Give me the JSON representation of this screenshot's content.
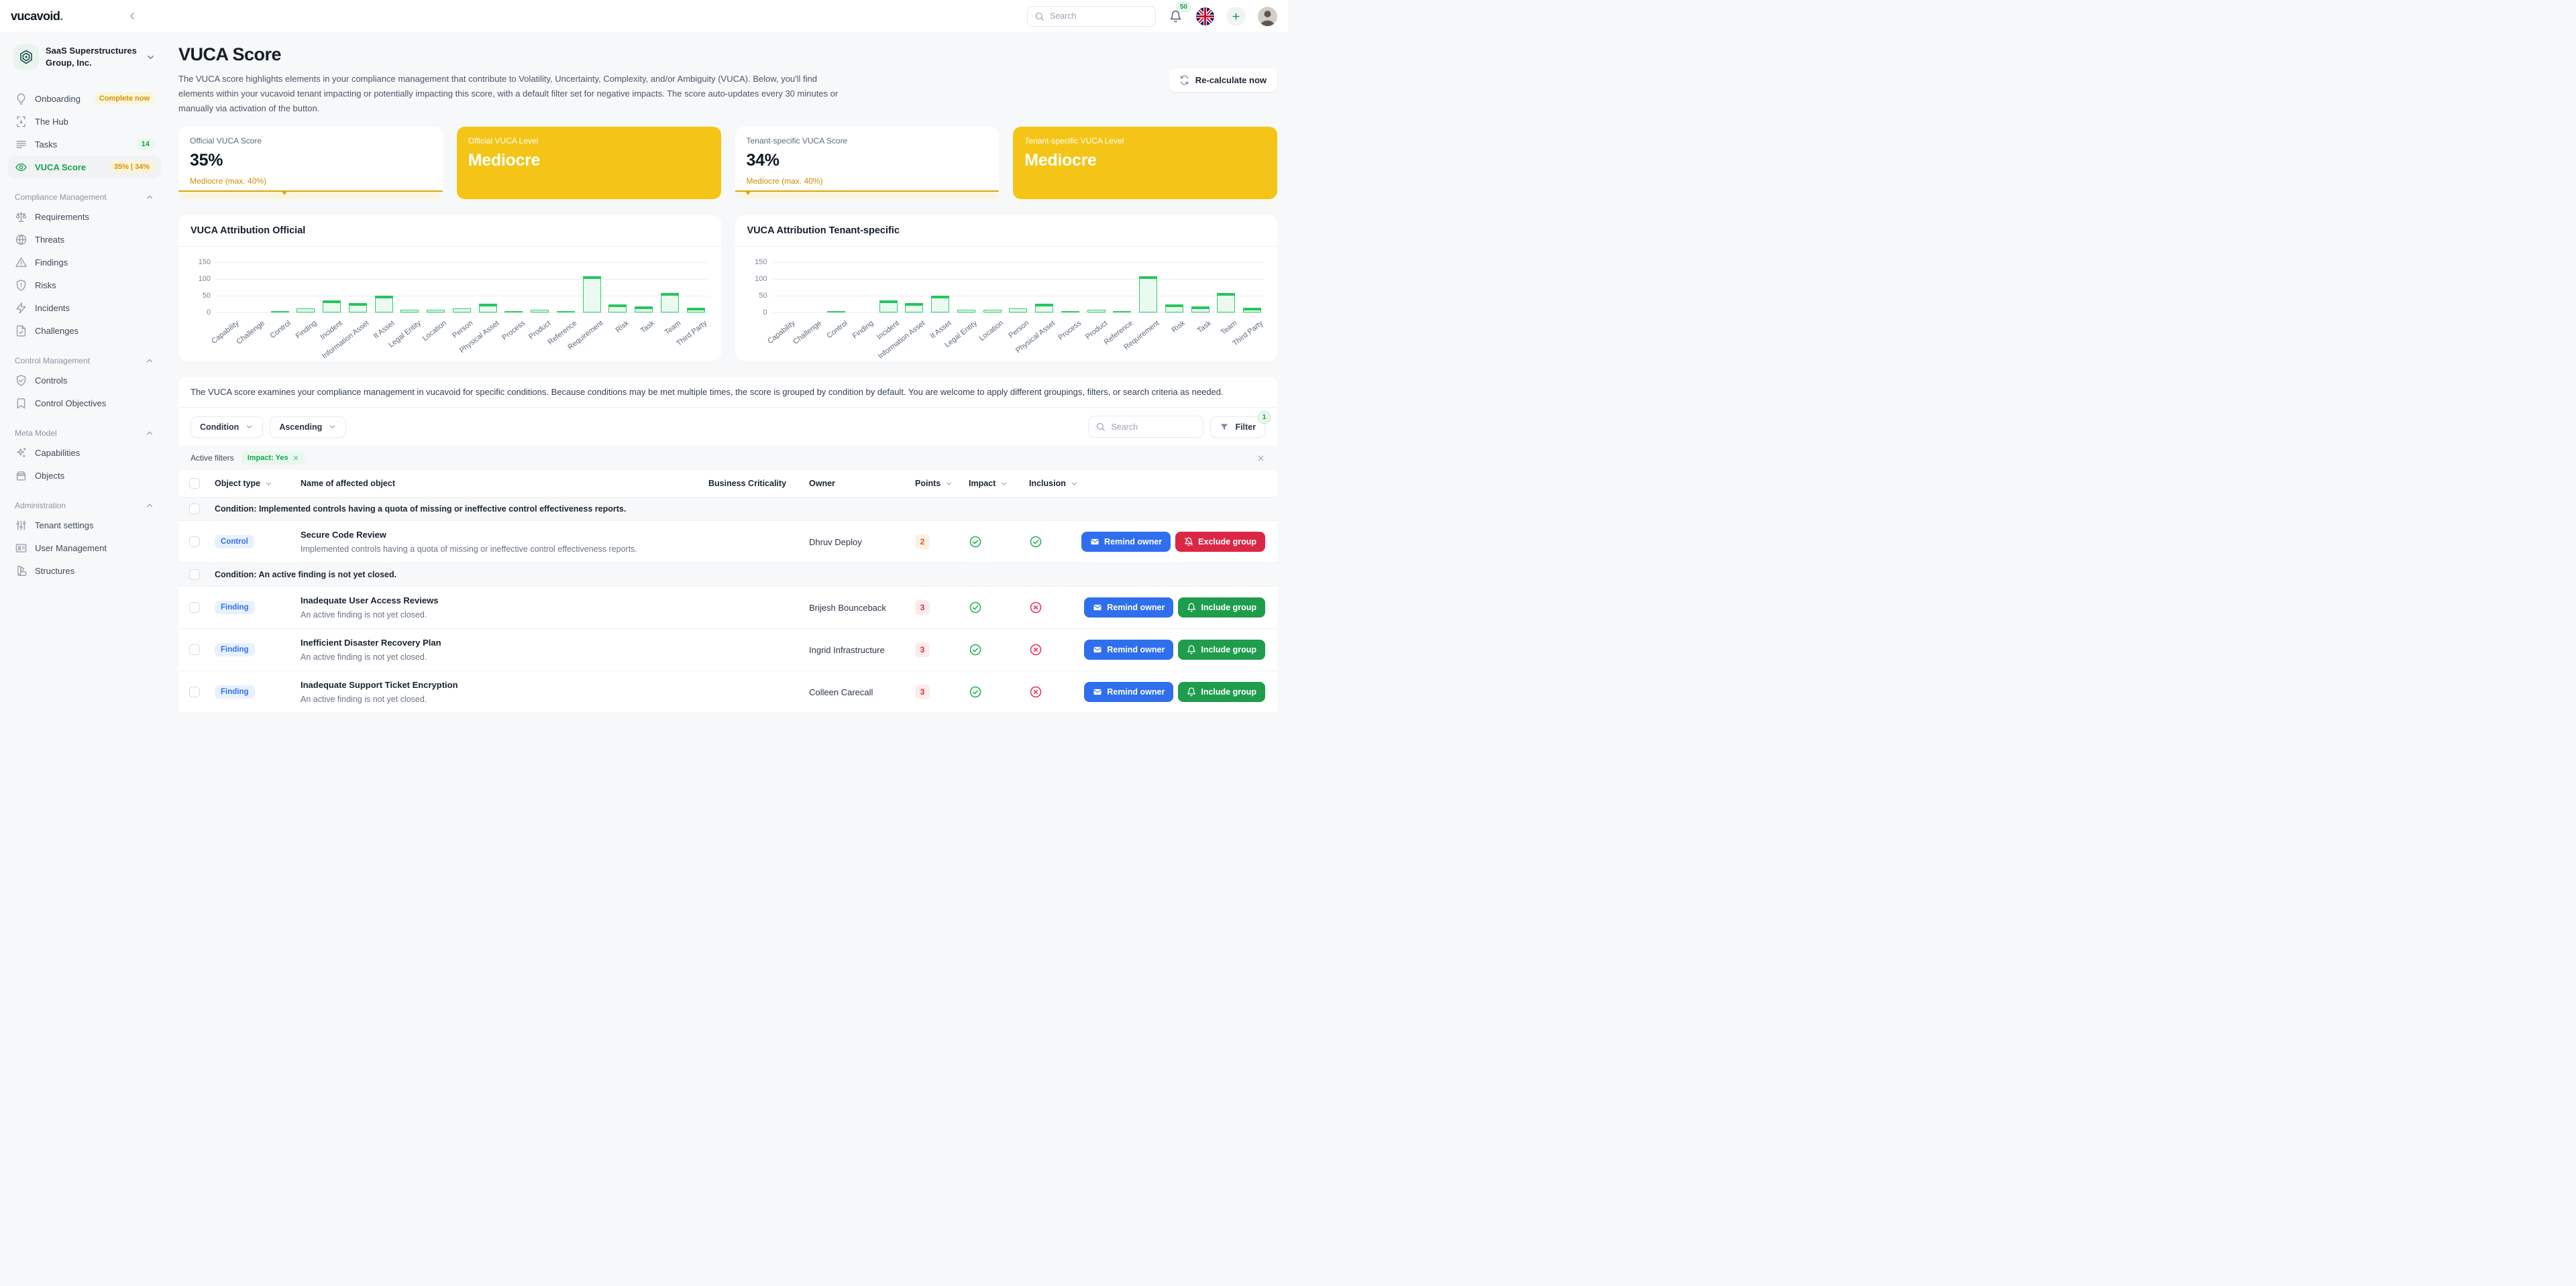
{
  "colors": {
    "accent_green": "#18a24b",
    "yellow": "#f4c516",
    "amber_text": "#c79104",
    "blue": "#2f6fed",
    "red": "#dc2645",
    "green_button": "#1f9d4d"
  },
  "topbar": {
    "logo": "vucavoid",
    "logo_dot": ".",
    "search_placeholder": "Search",
    "notification_count": "50"
  },
  "sidebar": {
    "org_name": "SaaS Superstructures Group, Inc.",
    "items_top": [
      {
        "label": "Onboarding",
        "icon": "lightbulb",
        "badge": "Complete now",
        "badge_style": "yellow"
      },
      {
        "label": "The Hub",
        "icon": "move"
      },
      {
        "label": "Tasks",
        "icon": "list",
        "badge": "14",
        "badge_style": "green"
      },
      {
        "label": "VUCA Score",
        "icon": "eye",
        "badge": "35% | 34%",
        "badge_style": "yellow",
        "active": true
      }
    ],
    "sections": [
      {
        "title": "Compliance Management",
        "items": [
          {
            "label": "Requirements",
            "icon": "scale"
          },
          {
            "label": "Threats",
            "icon": "globe"
          },
          {
            "label": "Findings",
            "icon": "alert-triangle"
          },
          {
            "label": "Risks",
            "icon": "shield-alert"
          },
          {
            "label": "Incidents",
            "icon": "zap"
          },
          {
            "label": "Challenges",
            "icon": "file-check"
          }
        ]
      },
      {
        "title": "Control Management",
        "items": [
          {
            "label": "Controls",
            "icon": "shield-check"
          },
          {
            "label": "Control Objectives",
            "icon": "bookmark"
          }
        ]
      },
      {
        "title": "Meta Model",
        "items": [
          {
            "label": "Capabilities",
            "icon": "sparkles"
          },
          {
            "label": "Objects",
            "icon": "box"
          }
        ]
      },
      {
        "title": "Administration",
        "items": [
          {
            "label": "Tenant settings",
            "icon": "sliders"
          },
          {
            "label": "User Management",
            "icon": "id-card"
          },
          {
            "label": "Structures",
            "icon": "swatch"
          }
        ]
      }
    ]
  },
  "header": {
    "title": "VUCA Score",
    "description": "The VUCA score highlights elements in your compliance management that contribute to Volatility, Uncertainty, Complexity, and/or Ambiguity (VUCA). Below, you'll find elements within your vucavoid tenant impacting or potentially impacting this score, with a default filter set for negative impacts. The score auto-updates every 30 minutes or manually via activation of the button.",
    "recalculate_label": "Re-calculate now"
  },
  "score_cards": [
    {
      "label": "Official VUCA Score",
      "value": "35%",
      "sublabel": "Mediocre (max. 40%)",
      "style": "white",
      "marker_pos": 40
    },
    {
      "label": "Official VUCA Level",
      "value": "Mediocre",
      "style": "yellow"
    },
    {
      "label": "Tenant-specific VUCA Score",
      "value": "34%",
      "sublabel": "Mediocre (max. 40%)",
      "style": "white",
      "marker_pos": 5
    },
    {
      "label": "Tenant-specific VUCA Level",
      "value": "Mediocre",
      "style": "yellow"
    }
  ],
  "chart_data": [
    {
      "type": "bar",
      "title": "VUCA Attribution Official",
      "categories": [
        "Capability",
        "Challenge",
        "Control",
        "Finding",
        "Incident",
        "Information Asset",
        "It Asset",
        "Legal Entity",
        "Location",
        "Person",
        "Physical Asset",
        "Process",
        "Product",
        "Reference",
        "Requirement",
        "Risk",
        "Task",
        "Team",
        "Third Party"
      ],
      "values": [
        0,
        0,
        2,
        13,
        36,
        29,
        50,
        8,
        8,
        13,
        26,
        2,
        8,
        3,
        108,
        25,
        19,
        59,
        14
      ],
      "xlabel": "",
      "ylabel": "",
      "ylim": [
        0,
        160
      ],
      "yticks": [
        0,
        50,
        100,
        150
      ],
      "grid": true,
      "legend": false,
      "bar_fill": "#eafaf1",
      "bar_border": "#2fce66"
    },
    {
      "type": "bar",
      "title": "VUCA Attribution Tenant-specific",
      "categories": [
        "Capability",
        "Challenge",
        "Control",
        "Finding",
        "Incident",
        "Information Asset",
        "It Asset",
        "Legal Entity",
        "Location",
        "Person",
        "Physical Asset",
        "Process",
        "Product",
        "Reference",
        "Requirement",
        "Risk",
        "Task",
        "Team",
        "Third Party"
      ],
      "values": [
        0,
        0,
        2,
        0,
        36,
        29,
        50,
        8,
        8,
        13,
        26,
        2,
        8,
        3,
        108,
        25,
        19,
        59,
        14
      ],
      "xlabel": "",
      "ylabel": "",
      "ylim": [
        0,
        160
      ],
      "yticks": [
        0,
        50,
        100,
        150
      ],
      "grid": true,
      "legend": false,
      "bar_fill": "#eafaf1",
      "bar_border": "#2fce66"
    }
  ],
  "table": {
    "intro": "The VUCA score examines your compliance management in vucavoid for specific conditions. Because conditions may be met multiple times, the score is grouped by condition by default. You are welcome to apply different groupings, filters, or search criteria as needed.",
    "sort_field": "Condition",
    "sort_direction": "Ascending",
    "search_placeholder": "Search",
    "filter_label": "Filter",
    "filter_count": "1",
    "active_filters_label": "Active filters",
    "active_filter_pill": "Impact: Yes",
    "columns": [
      {
        "label": "Object type",
        "sortable": true
      },
      {
        "label": "Name of affected object",
        "sortable": false
      },
      {
        "label": "Business Criticality",
        "sortable": false
      },
      {
        "label": "Owner",
        "sortable": false
      },
      {
        "label": "Points",
        "sortable": true
      },
      {
        "label": "Impact",
        "sortable": true
      },
      {
        "label": "Inclusion",
        "sortable": true
      }
    ],
    "groups": [
      {
        "condition": "Condition: Implemented controls having a quota of missing or ineffective control effectiveness reports.",
        "rows": [
          {
            "type": "Control",
            "name": "Secure Code Review",
            "description": "Implemented controls having a quota of missing or ineffective control effectiveness reports.",
            "criticality": "",
            "owner": "Dhruv Deploy",
            "points": "2",
            "points_color": "orange",
            "impact": "check",
            "inclusion": "check",
            "actions": [
              {
                "label": "Remind owner",
                "style": "blue",
                "icon": "mail"
              },
              {
                "label": "Exclude group",
                "style": "red",
                "icon": "bell-off"
              }
            ]
          }
        ]
      },
      {
        "condition": "Condition: An active finding is not yet closed.",
        "rows": [
          {
            "type": "Finding",
            "name": "Inadequate User Access Reviews",
            "description": "An active finding is not yet closed.",
            "criticality": "",
            "owner": "Brijesh Bounceback",
            "points": "3",
            "points_color": "red",
            "impact": "check",
            "inclusion": "x",
            "actions": [
              {
                "label": "Remind owner",
                "style": "blue",
                "icon": "mail"
              },
              {
                "label": "Include group",
                "style": "green",
                "icon": "bell"
              }
            ]
          },
          {
            "type": "Finding",
            "name": "Inefficient Disaster Recovery Plan",
            "description": "An active finding is not yet closed.",
            "criticality": "",
            "owner": "Ingrid Infrastructure",
            "points": "3",
            "points_color": "red",
            "impact": "check",
            "inclusion": "x",
            "actions": [
              {
                "label": "Remind owner",
                "style": "blue",
                "icon": "mail"
              },
              {
                "label": "Include group",
                "style": "green",
                "icon": "bell"
              }
            ]
          },
          {
            "type": "Finding",
            "name": "Inadequate Support Ticket Encryption",
            "description": "An active finding is not yet closed.",
            "criticality": "",
            "owner": "Colleen Carecall",
            "points": "3",
            "points_color": "red",
            "impact": "check",
            "inclusion": "x",
            "actions": [
              {
                "label": "Remind owner",
                "style": "blue",
                "icon": "mail"
              },
              {
                "label": "Include group",
                "style": "green",
                "icon": "bell"
              }
            ]
          }
        ]
      }
    ]
  }
}
